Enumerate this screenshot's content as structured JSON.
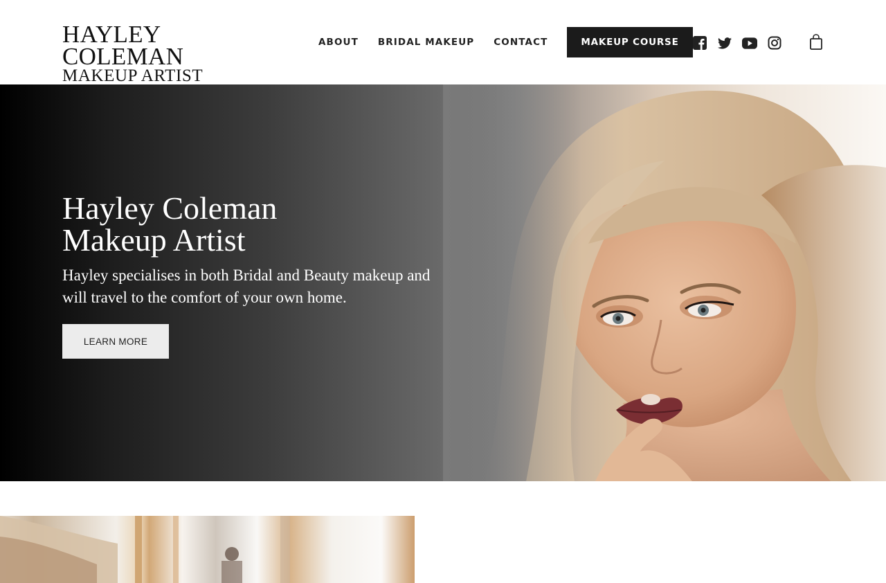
{
  "brand": {
    "line1": "HAYLEY COLEMAN",
    "line2": "MAKEUP ARTIST"
  },
  "nav": {
    "items": [
      {
        "label": "ABOUT"
      },
      {
        "label": "BRIDAL MAKEUP"
      },
      {
        "label": "CONTACT"
      }
    ],
    "cta_label": "MAKEUP COURSE"
  },
  "social": [
    "facebook-icon",
    "twitter-icon",
    "youtube-icon",
    "instagram-icon"
  ],
  "cart_icon": "shopping-bag-icon",
  "hero": {
    "title_line1": "Hayley Coleman",
    "title_line2": "Makeup Artist",
    "description": "Hayley specialises in both Bridal and Beauty makeup and will travel to the comfort of your own home.",
    "button_label": "LEARN MORE"
  },
  "colors": {
    "text_dark": "#222222",
    "cta_background": "#1b1b1b",
    "hero_gradient_start": "#000000",
    "button_light": "#ececec"
  }
}
